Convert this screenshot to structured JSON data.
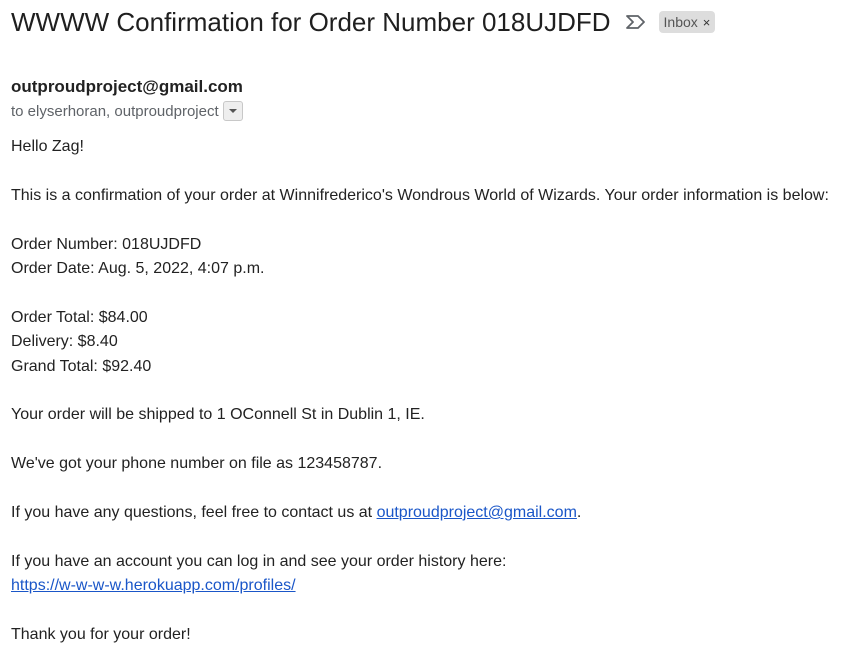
{
  "subject": "WWWW Confirmation for Order Number 018UJDFD",
  "label": {
    "text": "Inbox",
    "close": "×"
  },
  "sender": "outproudproject@gmail.com",
  "recipients": "to elyserhoran, outproudproject",
  "body": {
    "greeting": "Hello Zag!",
    "intro": "This is a confirmation of your order at Winnifrederico's Wondrous World of Wizards. Your order information is below:",
    "order_number": "Order Number: 018UJDFD",
    "order_date": "Order Date: Aug. 5, 2022, 4:07 p.m.",
    "order_total": "Order Total: $84.00",
    "delivery": "Delivery: $8.40",
    "grand_total": "Grand Total: $92.40",
    "shipping": "Your order will be shipped to 1 OConnell St in Dublin 1, IE.",
    "phone": "We've got your phone number on file as 123458787.",
    "questions_prefix": "If you have any questions, feel free to contact us at ",
    "questions_email": "outproudproject@gmail.com",
    "questions_suffix": ".",
    "account_text": "If you have an account you can log in and see your order history here:",
    "account_link": "https://w-w-w-w.herokuapp.com/profiles/",
    "thanks": "Thank you for your order!"
  },
  "icons": {
    "important": "important-marker-icon",
    "details": "chevron-down-icon"
  }
}
